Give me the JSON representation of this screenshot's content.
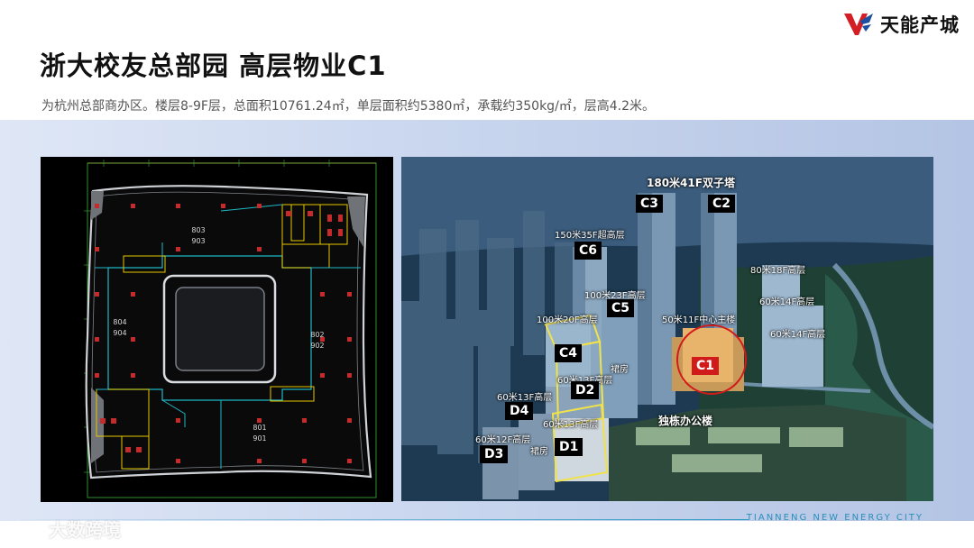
{
  "header": {
    "title": "浙大校友总部园  高层物业C1",
    "subtitle": "为杭州总部商办区。楼层8-9F层，总面积10761.24㎡，单层面积约5380㎡，承载约350kg/㎡，层高4.2米。"
  },
  "logo": {
    "text": "天能产城",
    "mark_color": "#d21f26",
    "mark_color_2": "#1d4fa0"
  },
  "floor_plan": {
    "units": [
      {
        "top": "803",
        "bottom": "903"
      },
      {
        "top": "804",
        "bottom": "904"
      },
      {
        "top": "802",
        "bottom": "902"
      },
      {
        "top": "801",
        "bottom": "901"
      }
    ]
  },
  "aerial": {
    "twin_tower_label": "180米41F双子塔",
    "tags": {
      "c3": "C3",
      "c2": "C2",
      "c6": "C6",
      "c5": "C5",
      "c4": "C4",
      "c1": "C1",
      "d2": "D2",
      "d4": "D4",
      "d1": "D1",
      "d3": "D3"
    },
    "labels": {
      "c6": "150米35F超高层",
      "c5": "100米23F高层",
      "c4": "100米20F高层",
      "c1": "50米11F中心主楼",
      "r1": "80米18F高层",
      "r2": "60米14F高层",
      "r3": "60米14F高层",
      "d2": "60米13F高层",
      "podium1": "裙房",
      "d4": "60米13F高层",
      "d1": "60米13F高层",
      "d3": "60米12F高层",
      "podium2": "裙房",
      "office": "独栋办公楼"
    },
    "highlight_color": "#d11a1a"
  },
  "footer": {
    "text": "TIANNENG NEW ENERGY CITY",
    "watermark": "大数跨境"
  }
}
